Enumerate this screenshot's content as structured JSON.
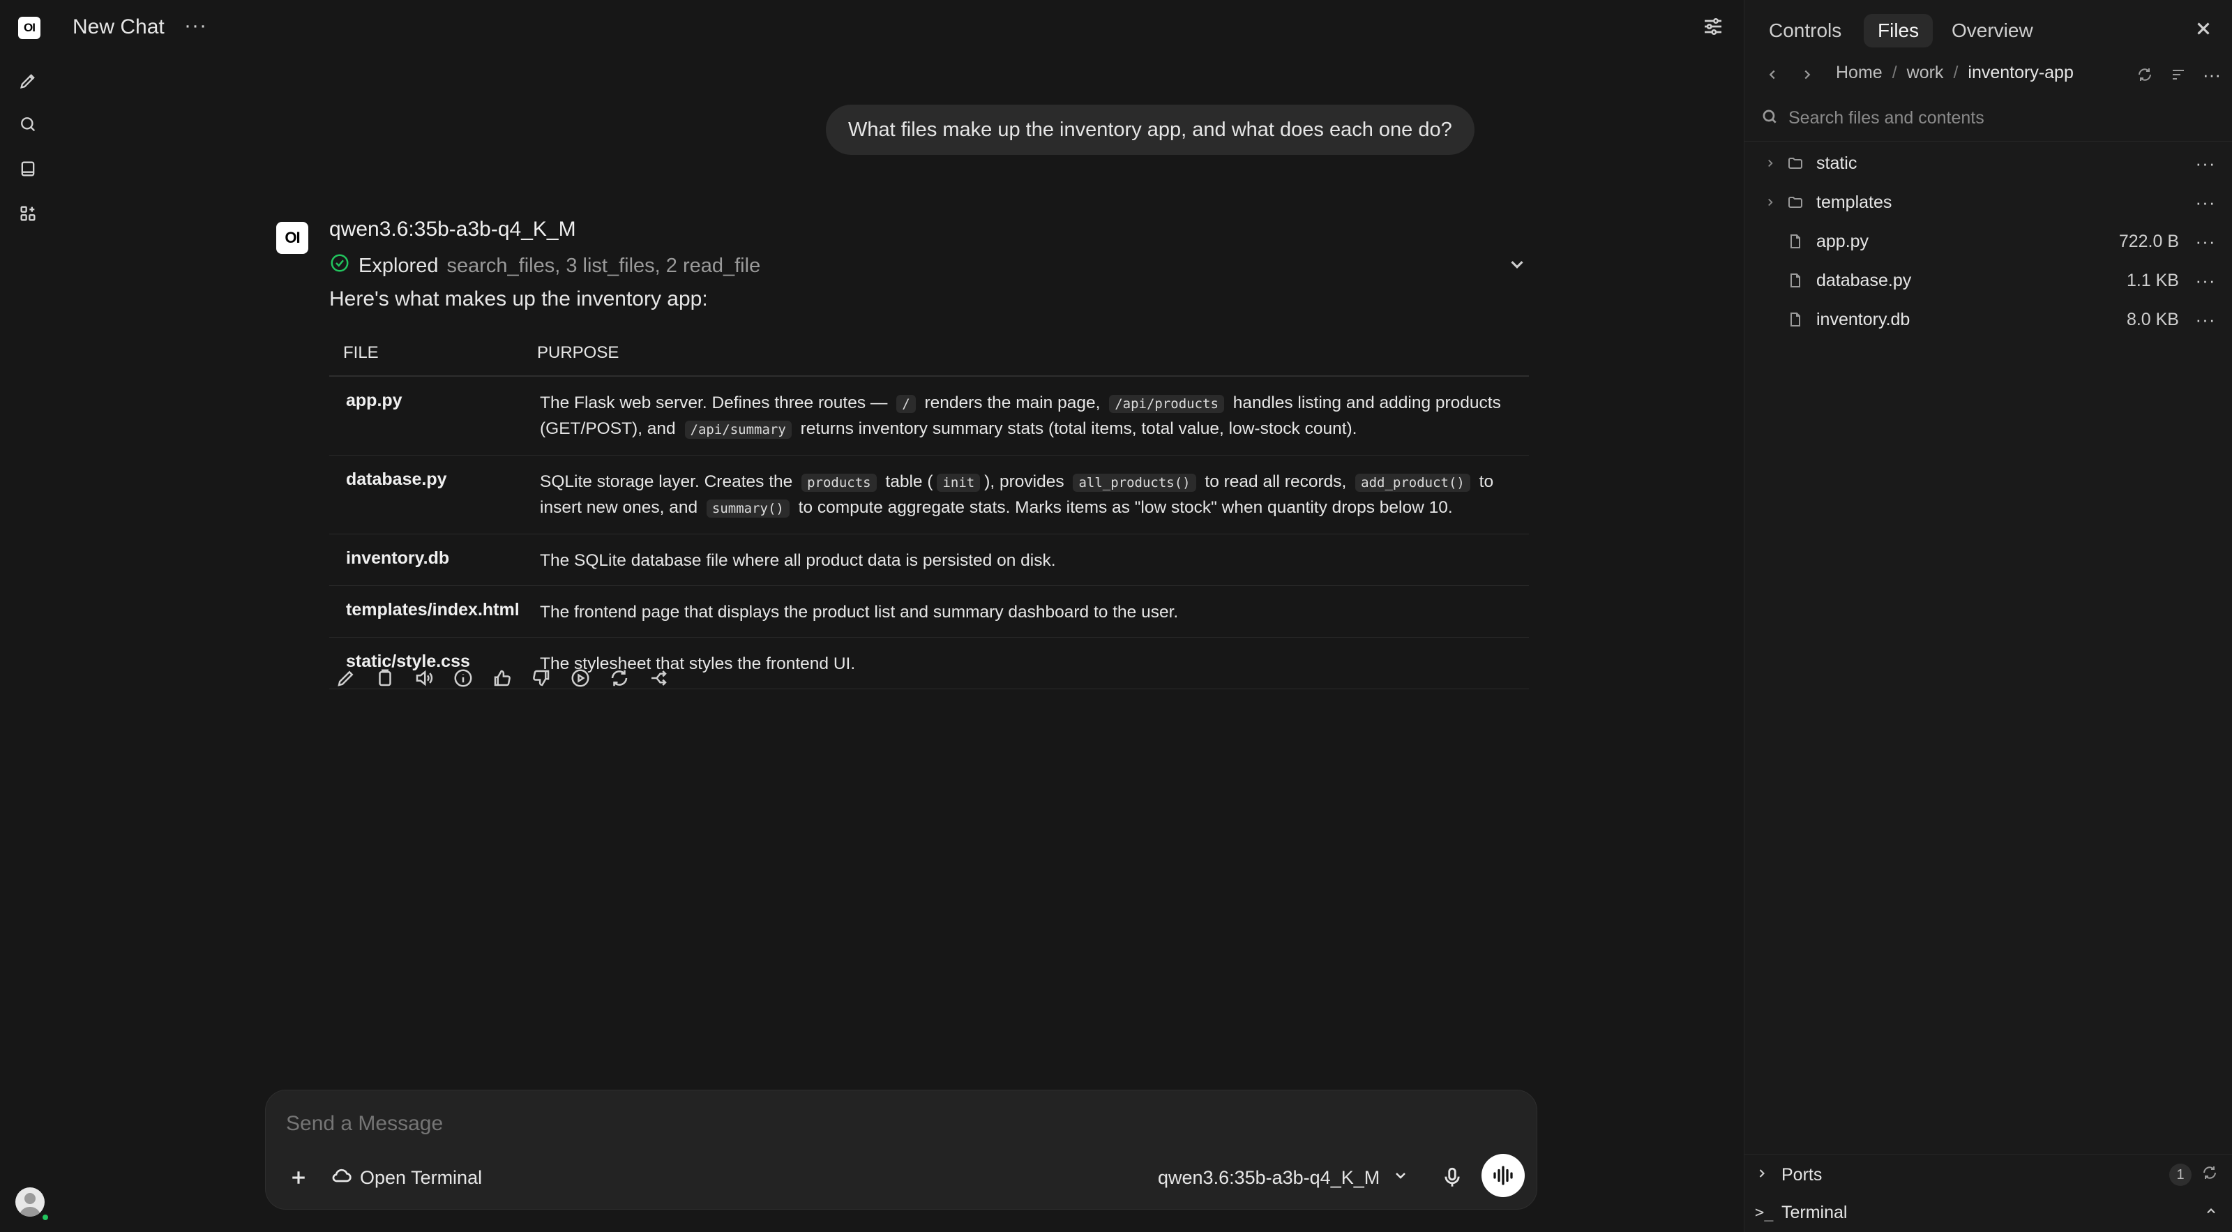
{
  "header": {
    "title": "New Chat",
    "more": "···"
  },
  "user_message": "What files make up the inventory app, and what does each one do?",
  "assistant": {
    "logo": "OI",
    "model": "qwen3.6:35b-a3b-q4_K_M",
    "explored_label": "Explored",
    "explored_detail": "search_files, 3 list_files, 2 read_file",
    "intro": "Here's what makes up the inventory app:",
    "table": {
      "headers": [
        "FILE",
        "PURPOSE"
      ],
      "rows": [
        {
          "file": "app.py",
          "p": [
            "The Flask web server. Defines three routes — ",
            "/",
            " renders the main page, ",
            "/api/products",
            " handles listing and adding products (GET/POST), and ",
            "/api/summary",
            " returns inventory summary stats (total items, total value, low-stock count)."
          ]
        },
        {
          "file": "database.py",
          "p": [
            "SQLite storage layer. Creates the ",
            "products",
            " table (",
            "init",
            "), provides ",
            "all_products()",
            " to read all records, ",
            "add_product()",
            " to insert new ones, and ",
            "summary()",
            " to compute aggregate stats. Marks items as \"low stock\" when quantity drops below 10."
          ]
        },
        {
          "file": "inventory.db",
          "p": [
            "The SQLite database file where all product data is persisted on disk."
          ]
        },
        {
          "file": "templates/index.html",
          "p": [
            "The frontend page that displays the product list and summary dashboard to the user."
          ]
        },
        {
          "file": "static/style.css",
          "p": [
            "The stylesheet that styles the frontend UI."
          ]
        }
      ]
    },
    "actions": [
      "edit-icon",
      "copy-icon",
      "speaker-icon",
      "info-icon",
      "thumbs-up-icon",
      "thumbs-down-icon",
      "play-icon",
      "regenerate-icon",
      "branch-icon"
    ]
  },
  "composer": {
    "placeholder": "Send a Message",
    "open_terminal": "Open Terminal",
    "model": "qwen3.6:35b-a3b-q4_K_M"
  },
  "panel": {
    "tabs": [
      "Controls",
      "Files",
      "Overview"
    ],
    "active_tab": "Files",
    "breadcrumbs": [
      "Home",
      "work",
      "inventory-app"
    ],
    "search_placeholder": "Search files and contents",
    "items": [
      {
        "name": "static",
        "type": "folder",
        "size": ""
      },
      {
        "name": "templates",
        "type": "folder",
        "size": ""
      },
      {
        "name": "app.py",
        "type": "file",
        "size": "722.0 B"
      },
      {
        "name": "database.py",
        "type": "file",
        "size": "1.1 KB"
      },
      {
        "name": "inventory.db",
        "type": "file",
        "size": "8.0 KB"
      }
    ],
    "ports_label": "Ports",
    "ports_count": "1",
    "terminal_label": "Terminal"
  },
  "colors": {
    "background": "#171717",
    "panel": "#1a1a1a",
    "bubble": "#2b2b2b",
    "success": "#22c55e"
  }
}
